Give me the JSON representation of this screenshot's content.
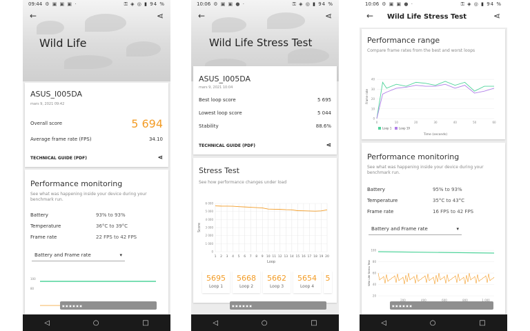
{
  "colors": {
    "accent": "#f39c26",
    "green": "#4ed39a",
    "purple": "#b07ee8",
    "blue": "#4a7fd4"
  },
  "phone1": {
    "status": {
      "time": "09:44",
      "battery": "94 %"
    },
    "title": "Wild Life",
    "device": {
      "name": "ASUS_I005DA",
      "date": "mars 9, 2021 09:42"
    },
    "overall_label": "Overall score",
    "overall_value": "5 694",
    "fps_label": "Average frame rate (FPS)",
    "fps_value": "34.10",
    "tech_label": "TECHNICAL GUIDE (PDF)",
    "perf": {
      "title": "Performance monitoring",
      "subtitle": "See what was happening inside your device during your benchmark run.",
      "battery_label": "Battery",
      "battery_value": "93% to 93%",
      "temp_label": "Temperature",
      "temp_value": "36°C to 39°C",
      "fr_label": "Frame rate",
      "fr_value": "22 FPS to 42 FPS",
      "dropdown": "Battery and Frame rate"
    },
    "mini_ticks": [
      "100",
      "80"
    ]
  },
  "phone2": {
    "status": {
      "time": "10:06",
      "battery": "94 %"
    },
    "title": "Wild Life Stress Test",
    "device": {
      "name": "ASUS_I005DA",
      "date": "mars 9, 2021 10:04"
    },
    "best_label": "Best loop score",
    "best_value": "5 695",
    "lowest_label": "Lowest loop score",
    "lowest_value": "5 044",
    "stab_label": "Stability",
    "stab_value": "88.6%",
    "tech_label": "TECHNICAL GUIDE (PDF)",
    "stress": {
      "title": "Stress Test",
      "subtitle": "See how performance changes under load"
    },
    "loops": [
      {
        "value": "5695",
        "label": "Loop 1"
      },
      {
        "value": "5668",
        "label": "Loop 2"
      },
      {
        "value": "5662",
        "label": "Loop 3"
      },
      {
        "value": "5654",
        "label": "Loop 4"
      },
      {
        "value": "5",
        "label": ""
      }
    ]
  },
  "phone3": {
    "status": {
      "time": "10:06",
      "battery": "94 %"
    },
    "title": "Wild Life Stress Test",
    "range": {
      "title": "Performance range",
      "subtitle": "Compare frame rates from the best and worst loops",
      "legend1": "Loop 1",
      "legend2": "Loop 19",
      "xlabel": "Time (seconds)",
      "ylabel": "Frame rate"
    },
    "perf": {
      "title": "Performance monitoring",
      "subtitle": "See what was happening inside your device during your benchmark run.",
      "battery_label": "Battery",
      "battery_value": "95% to 93%",
      "temp_label": "Temperature",
      "temp_value": "35°C to 43°C",
      "fr_label": "Frame rate",
      "fr_value": "16 FPS to 42 FPS",
      "dropdown": "Battery and Frame rate",
      "ylabel": "Wild Life Stress Test",
      "xlabel": "Time (seconds)"
    },
    "monitor_ticks": [
      "100",
      "80",
      "60",
      "40",
      "20"
    ]
  },
  "chart_data": [
    {
      "type": "line",
      "title": "",
      "xlabel": "Loop",
      "ylabel": "Score",
      "x": [
        1,
        2,
        3,
        4,
        5,
        6,
        7,
        8,
        9,
        10,
        11,
        12,
        13,
        14,
        15,
        16,
        17,
        18,
        19,
        20
      ],
      "series": [
        {
          "values": [
            5695,
            5668,
            5662,
            5654,
            5600,
            5560,
            5520,
            5480,
            5440,
            5300,
            5280,
            5260,
            5220,
            5200,
            5100,
            5080,
            5060,
            5044,
            5070,
            5200
          ]
        }
      ],
      "yticks": [
        "6 000",
        "5 000",
        "4 000",
        "3 000",
        "2 000",
        "1 000",
        "0"
      ],
      "ylim": [
        0,
        6000
      ]
    },
    {
      "type": "line",
      "title": "Performance range",
      "xlabel": "Time (seconds)",
      "ylabel": "Frame rate",
      "x": [
        0,
        3,
        5,
        10,
        15,
        20,
        25,
        30,
        35,
        40,
        45,
        50,
        55,
        60
      ],
      "series": [
        {
          "name": "Loop 1",
          "values": [
            0,
            37,
            31,
            35,
            33,
            37,
            36,
            34,
            38,
            34,
            37,
            28,
            33,
            33
          ]
        },
        {
          "name": "Loop 19",
          "values": [
            0,
            25,
            27,
            31,
            32,
            34,
            33,
            33,
            35,
            31,
            34,
            26,
            28,
            31
          ]
        }
      ],
      "xticks": [
        "0",
        "10",
        "20",
        "30",
        "40",
        "50",
        "60"
      ],
      "yticks": [
        "40",
        "30",
        "20",
        "10",
        "0"
      ],
      "ylim": [
        0,
        45
      ]
    }
  ],
  "monitor_xticks": [
    "200",
    "400",
    "600",
    "800",
    "1 000"
  ]
}
